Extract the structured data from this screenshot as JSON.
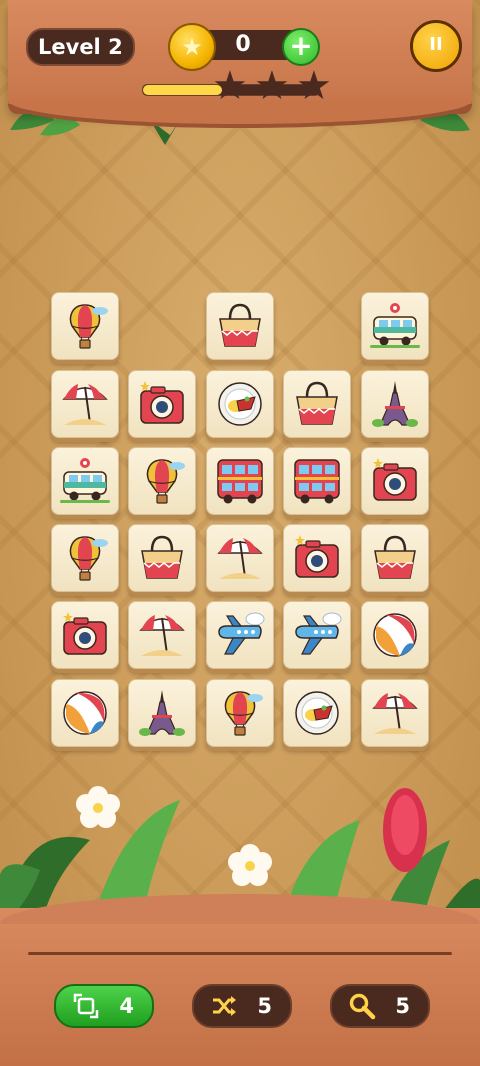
{
  "header": {
    "level_label": "Level 2",
    "coins": "0",
    "plus_label": "+",
    "pause_label": "II",
    "progress_fraction": 0.45,
    "stars_total": 3,
    "stars_earned": 0
  },
  "board": {
    "tiles": [
      {
        "row": 0,
        "col": 0,
        "item": "hot-air-balloon"
      },
      {
        "row": 0,
        "col": 2,
        "item": "beach-bag"
      },
      {
        "row": 0,
        "col": 4,
        "item": "camper-van"
      },
      {
        "row": 1,
        "col": 0,
        "item": "beach-umbrella"
      },
      {
        "row": 1,
        "col": 1,
        "item": "camera"
      },
      {
        "row": 1,
        "col": 2,
        "item": "food-plate"
      },
      {
        "row": 1,
        "col": 3,
        "item": "beach-bag"
      },
      {
        "row": 1,
        "col": 4,
        "item": "eiffel-tower"
      },
      {
        "row": 2,
        "col": 0,
        "item": "camper-van"
      },
      {
        "row": 2,
        "col": 1,
        "item": "hot-air-balloon"
      },
      {
        "row": 2,
        "col": 2,
        "item": "double-decker-bus"
      },
      {
        "row": 2,
        "col": 3,
        "item": "double-decker-bus"
      },
      {
        "row": 2,
        "col": 4,
        "item": "camera"
      },
      {
        "row": 3,
        "col": 0,
        "item": "hot-air-balloon"
      },
      {
        "row": 3,
        "col": 1,
        "item": "beach-bag"
      },
      {
        "row": 3,
        "col": 2,
        "item": "beach-umbrella"
      },
      {
        "row": 3,
        "col": 3,
        "item": "camera"
      },
      {
        "row": 3,
        "col": 4,
        "item": "beach-bag"
      },
      {
        "row": 4,
        "col": 0,
        "item": "camera"
      },
      {
        "row": 4,
        "col": 1,
        "item": "beach-umbrella"
      },
      {
        "row": 4,
        "col": 2,
        "item": "airplane"
      },
      {
        "row": 4,
        "col": 3,
        "item": "airplane"
      },
      {
        "row": 4,
        "col": 4,
        "item": "beach-ball"
      },
      {
        "row": 5,
        "col": 0,
        "item": "beach-ball"
      },
      {
        "row": 5,
        "col": 1,
        "item": "eiffel-tower"
      },
      {
        "row": 5,
        "col": 2,
        "item": "hot-air-balloon"
      },
      {
        "row": 5,
        "col": 3,
        "item": "food-plate"
      },
      {
        "row": 5,
        "col": 4,
        "item": "beach-umbrella"
      }
    ]
  },
  "tools": {
    "undo_count": "4",
    "shuffle_count": "5",
    "hint_count": "5",
    "undo_icon": "undo-icon",
    "shuffle_icon": "shuffle-icon",
    "hint_icon": "magnifier-icon"
  },
  "colors": {
    "wood": "#c77449",
    "dark_pill": "#4a2a1e",
    "coin": "#f5b400",
    "green_button": "#2fb82a",
    "tile": "#f6ead0"
  }
}
